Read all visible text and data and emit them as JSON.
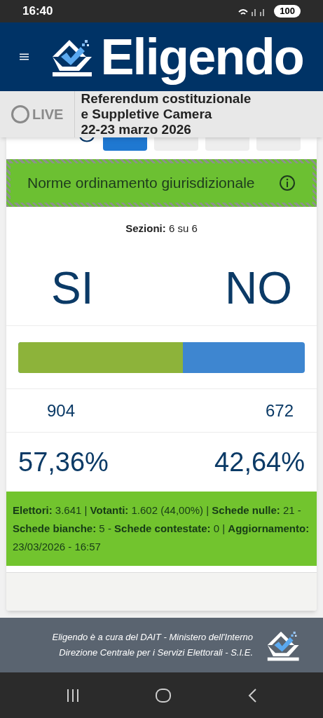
{
  "status_bar": {
    "time": "16:40",
    "battery": "100"
  },
  "header": {
    "title": "Eligendo"
  },
  "live_bar": {
    "label": "LIVE",
    "title_lines": [
      "Referendum costituzionale",
      "e Suppletive Camera",
      "22-23 marzo 2026"
    ]
  },
  "view_tabs": [
    {
      "selected": true
    },
    {
      "selected": false
    },
    {
      "selected": false
    },
    {
      "selected": false
    }
  ],
  "question": {
    "title": "Norme ordinamento giurisdizionale"
  },
  "sections": "**Sezioni:** 6 su 6",
  "options": [
    {
      "label": "SI",
      "votes": "904",
      "percent": "57,36%",
      "level": 0.5736
    },
    {
      "label": "NO",
      "votes": "672",
      "percent": "42,64%"
    }
  ],
  "summary": "**Elettori:** 3.641 | **Votanti:** 1.602 (44,00%) | **Schede nulle:** 21 - **Schede bianche:** 5 - **Schede contestate:** 0 | **Aggiornamento:** 23/03/2026 - 16:57",
  "footer": {
    "lines": [
      "Eligendo è a cura del DAIT - Ministero dell'Interno",
      "Direzione Centrale per i Servizi Elettorali - S.I.E."
    ]
  }
}
